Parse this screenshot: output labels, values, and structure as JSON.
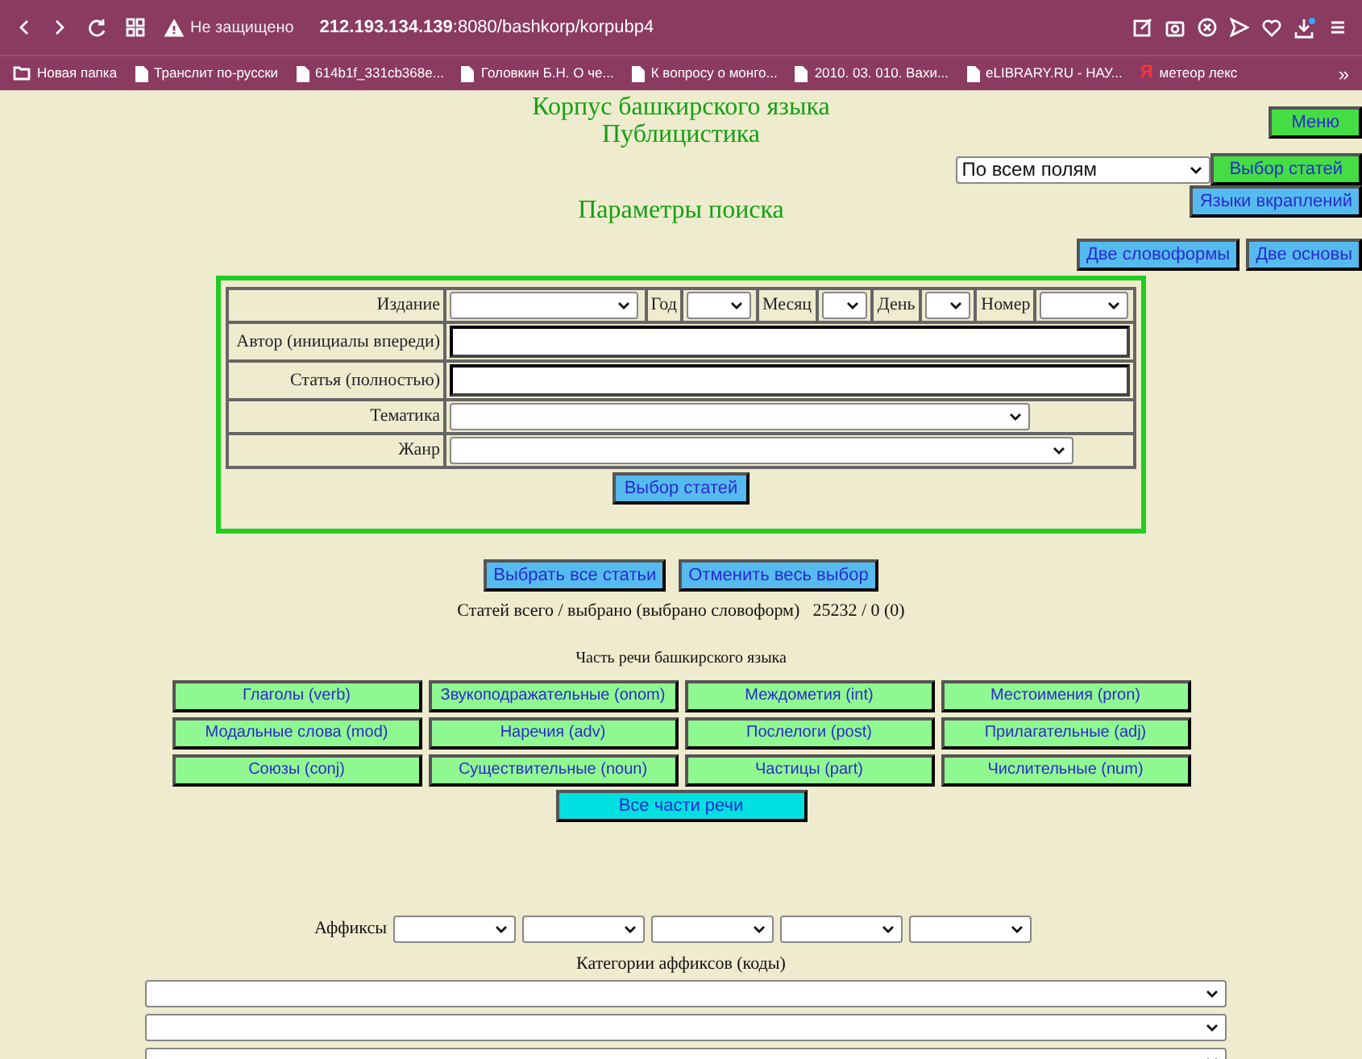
{
  "browser": {
    "security": "Не защищено",
    "url_host": "212.193.134.139",
    "url_path": ":8080/bashkorp/korpubp4",
    "bookmarks": [
      {
        "kind": "folder",
        "label": "Новая папка"
      },
      {
        "kind": "page",
        "label": "Транслит по-русски"
      },
      {
        "kind": "page",
        "label": "614b1f_331cb368e..."
      },
      {
        "kind": "page",
        "label": "Головкин Б.Н. О че..."
      },
      {
        "kind": "page",
        "label": "К вопросу о монго..."
      },
      {
        "kind": "page",
        "label": "2010. 03. 010. Вахи..."
      },
      {
        "kind": "page",
        "label": "eLIBRARY.RU - НАУ..."
      },
      {
        "kind": "yandex",
        "glyph": "Я",
        "label": "метеор лекс"
      }
    ],
    "more": "»"
  },
  "header": {
    "title": "Корпус башкирского языка",
    "subtitle": "Публицистика",
    "menu_button": "Меню",
    "field_select": "По всем полям",
    "select_button": "Выбор статей",
    "languages_button": "Языки вкраплений",
    "section_title": "Параметры поиска",
    "two_forms_button": "Две словоформы",
    "two_stems_button": "Две основы"
  },
  "search_form": {
    "date_row": [
      {
        "label": "Издание"
      },
      {
        "label": "Год"
      },
      {
        "label": "Месяц"
      },
      {
        "label": "День"
      },
      {
        "label": "Номер"
      }
    ],
    "rows": [
      {
        "kind": "text",
        "label": "Автор (инициалы впереди)"
      },
      {
        "kind": "text",
        "label": "Статья (полностью)"
      },
      {
        "kind": "select",
        "label": "Тематика"
      },
      {
        "kind": "select",
        "label": "Жанр"
      }
    ],
    "submit": "Выбор статей"
  },
  "selection": {
    "select_all": "Выбрать все статьи",
    "clear_all": "Отменить весь выбор",
    "stats_label": "Статей всего / выбрано (выбрано словоформ)",
    "stats_value": "25232 / 0 (0)"
  },
  "parts_of_speech": {
    "title": "Часть речи башкирского языка",
    "items": [
      "Глаголы (verb)",
      "Звукоподражательные (onom)",
      "Междометия (int)",
      "Местоимения (pron)",
      "Модальные слова (mod)",
      "Наречия (adv)",
      "Послелоги (post)",
      "Прилагательные (adj)",
      "Союзы (conj)",
      "Существительные (noun)",
      "Частицы (part)",
      "Числительные (num)"
    ],
    "all_button": "Все части речи"
  },
  "affixes": {
    "label": "Аффиксы",
    "categories_title": "Категории аффиксов (коды)"
  }
}
